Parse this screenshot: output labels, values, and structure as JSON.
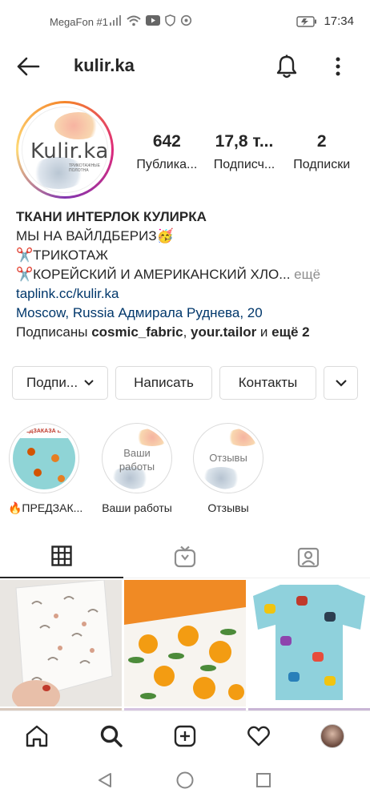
{
  "status_bar": {
    "carrier": "MegaFon #1",
    "time": "17:34",
    "icons": [
      "signal-icon",
      "wifi-icon",
      "youtube-icon",
      "shield-icon",
      "sync-icon",
      "battery-icon"
    ]
  },
  "header": {
    "username": "kulir.ka"
  },
  "profile": {
    "avatar_logo": "Kulir.ka",
    "avatar_sub": "трикотажные полотна",
    "stats": [
      {
        "value": "642",
        "label": "Публика..."
      },
      {
        "value": "17,8 т...",
        "label": "Подписч..."
      },
      {
        "value": "2",
        "label": "Подписки"
      }
    ]
  },
  "bio": {
    "name": "ТКАНИ ИНТЕРЛОК КУЛИРКА",
    "line1": "МЫ НА ВАЙЛДБЕРИЗ🥳",
    "line2": "✂️ТРИКОТАЖ",
    "line3": "✂️КОРЕЙСКИЙ И АМЕРИКАНСКИЙ ХЛО...",
    "more": " ещё",
    "link": "taplink.cc/kulir.ka",
    "location": "Moscow, Russia Адмирала Руднева, 20",
    "followed_prefix": "Подписаны ",
    "followed_user1": "cosmic_fabric",
    "followed_sep": ", ",
    "followed_user2": "your.tailor",
    "followed_and": " и ",
    "followed_more": "ещё 2"
  },
  "actions": {
    "subscribe": "Подпи...",
    "message": "Написать",
    "contacts": "Контакты"
  },
  "highlights": [
    {
      "label": "🔥ПРЕДЗАК...",
      "cover_text": "ПРЕДЗАКАЗА ВЫ"
    },
    {
      "label": "Ваши работы",
      "cover_text": "Ваши работы"
    },
    {
      "label": "Отзывы",
      "cover_text": "Отзывы"
    }
  ],
  "colors": {
    "link": "#00376b",
    "text": "#262626",
    "muted": "#8e8e8e",
    "border": "#dbdbdb"
  }
}
